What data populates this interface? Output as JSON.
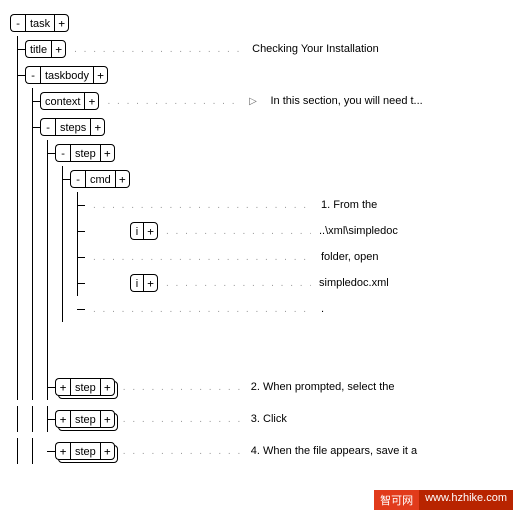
{
  "glyphs": {
    "minus": "-",
    "plus": "+",
    "arrow": "▷"
  },
  "nodes": {
    "task": "task",
    "title": "title",
    "taskbody": "taskbody",
    "context": "context",
    "steps": "steps",
    "step": "step",
    "cmd": "cmd",
    "i": "i"
  },
  "content": {
    "title_text": "Checking Your Installation",
    "context_text": "In this section, you will need t...",
    "cmd_line1": "1. From the",
    "cmd_line2": "..\\xml\\simpledoc",
    "cmd_line3": "folder, open",
    "cmd_line4": "simpledoc.xml",
    "cmd_line5": ".",
    "step2": "2. When prompted, select the",
    "step3": "3. Click",
    "step4": "4. When the file appears, save it a"
  },
  "watermark": {
    "label": "智可网",
    "url": "www.hzhike.com"
  }
}
